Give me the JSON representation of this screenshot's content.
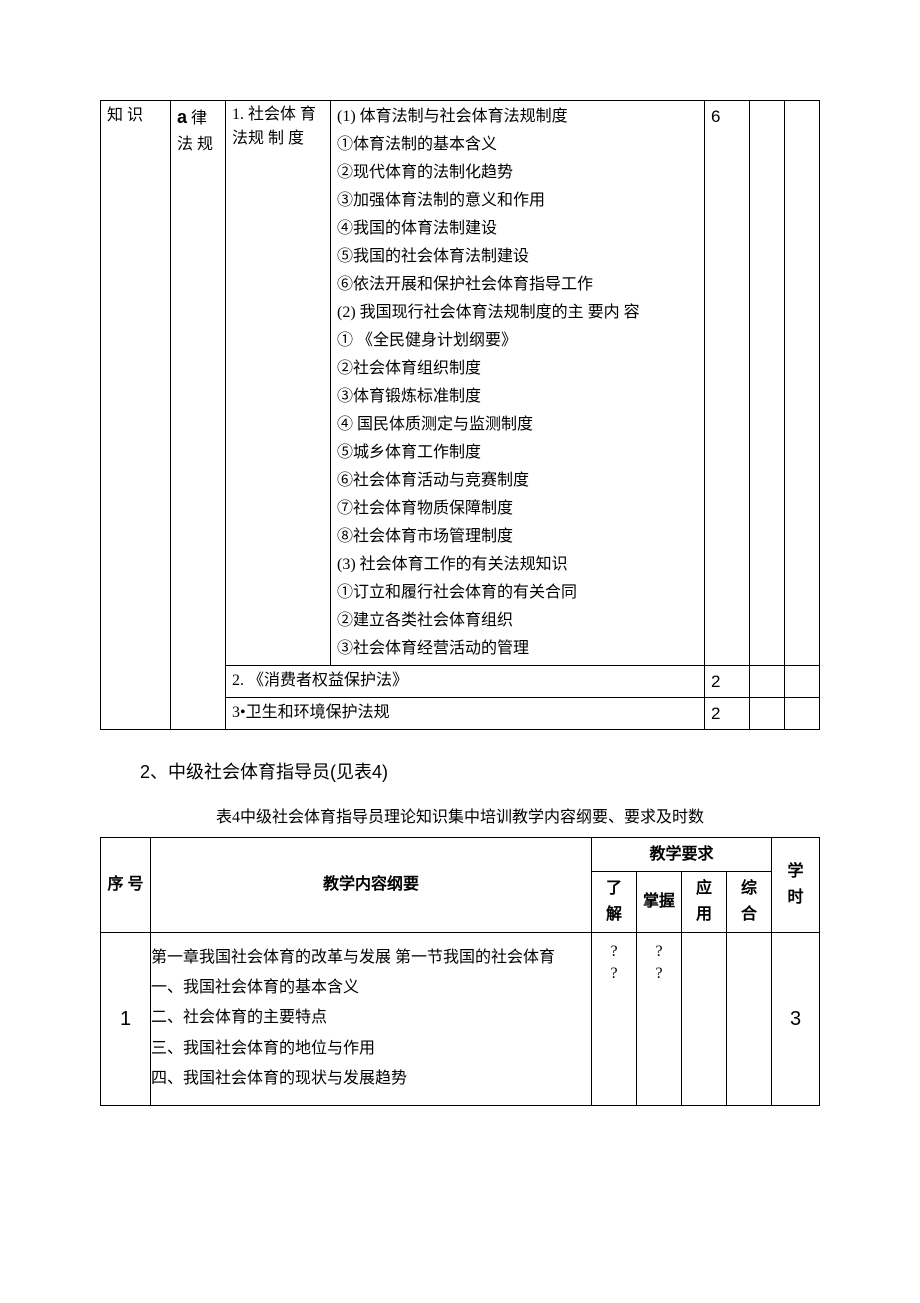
{
  "table1": {
    "col1": "知 识",
    "col2_a": "a",
    "col2_rest": " 律 法 规",
    "row1": {
      "c3": "1. 社会体 育\n法规 制 度",
      "c4": "(1) 体育法制与社会体育法规制度\n①体育法制的基本含义\n②现代体育的法制化趋势\n③加强体育法制的意义和作用\n④我国的体育法制建设\n⑤我国的社会体育法制建设\n⑥依法开展和保护社会体育指导工作\n(2) 我国现行社会体育法规制度的主 要内 容\n① 《全民健身计划纲要》\n②社会体育组织制度\n③体育锻炼标准制度\n④ 国民体质测定与监测制度\n⑤城乡体育工作制度\n⑥社会体育活动与竞赛制度\n⑦社会体育物质保障制度\n⑧社会体育市场管理制度\n(3) 社会体育工作的有关法规知识\n①订立和履行社会体育的有关合同\n②建立各类社会体育组织\n③社会体育经营活动的管理",
      "c5": "6"
    },
    "row2": {
      "c3": "2. 《消费者权益保护法》",
      "c5": "2"
    },
    "row3": {
      "c3": "3•卫生和环境保护法规",
      "c5": "2"
    }
  },
  "midHeading": "2、中级社会体育指导员(见表4)",
  "table4Caption": "表4中级社会体育指导员理论知识集中培训教学内容纲要、要求及时数",
  "table2": {
    "head": {
      "xu": "序 号",
      "outline": "教学内容纲要",
      "reqGroup": "教学要求",
      "liaojie": "了 解",
      "zhangwo": "掌握",
      "yingyong": "应 用",
      "zonghe": "综 合",
      "xueshi": "学 时"
    },
    "row1": {
      "no": "1",
      "outline": "第一章我国社会体育的改革与发展  第一节我国的社会体育\n一、我国社会体育的基本含义\n二、社会体育的主要特点\n三、我国社会体育的地位与作用\n四、我国社会体育的现状与发展趋势",
      "lj": "?\n?",
      "zw": "?\n?",
      "yy": "",
      "zh": "",
      "xs": "3"
    }
  }
}
